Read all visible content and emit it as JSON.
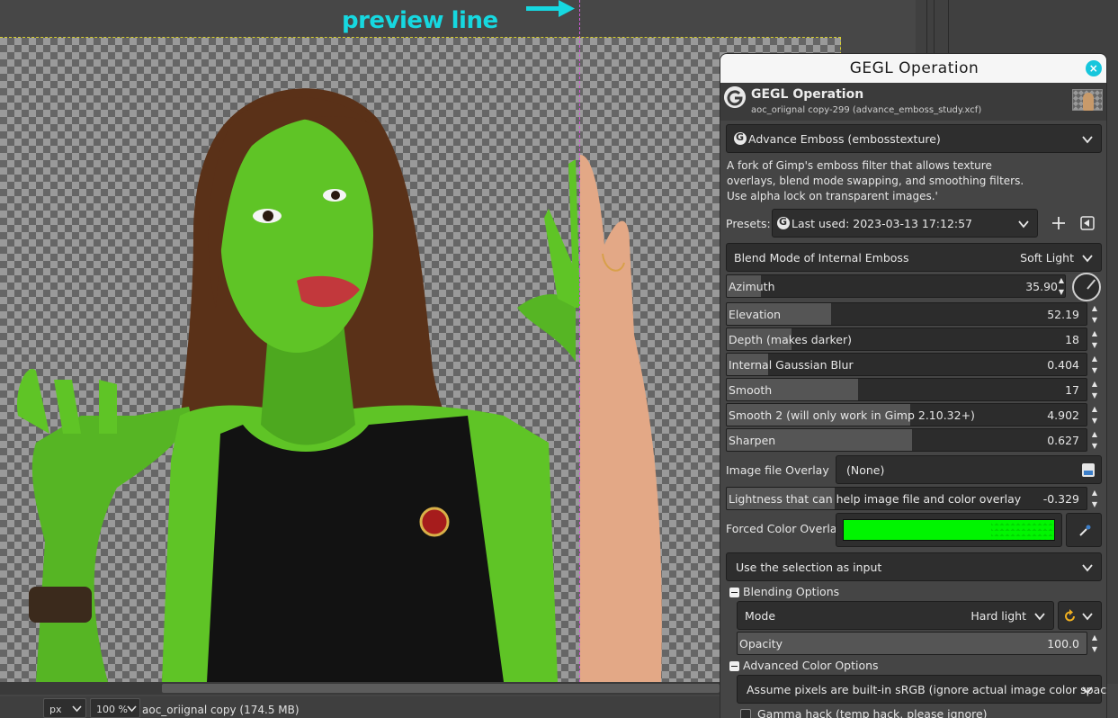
{
  "canvas": {
    "annotation": "preview line"
  },
  "statusbar": {
    "unit": "px",
    "zoom": "100 %",
    "image_info": "aoc_oriignal copy (174.5 MB)"
  },
  "dialog": {
    "window_title": "GEGL Operation",
    "header_title": "GEGL Operation",
    "header_subtitle": "aoc_oriignal copy-299 (advance_emboss_study.xcf)",
    "operation": "Advance Emboss (embosstexture)",
    "description": [
      "A fork of Gimp's emboss filter that allows texture",
      "overlays, blend mode swapping, and smoothing filters.",
      "Use alpha lock on transparent images.'"
    ],
    "presets_label": "Presets:",
    "presets_value": "Last used: 2023-03-13 17:12:57",
    "blend_label": "Blend Mode of Internal Emboss",
    "blend_value": "Soft Light",
    "sliders": [
      {
        "label": "Azimuth",
        "value": "35.90",
        "fill": 0.1
      },
      {
        "label": "Elevation",
        "value": "52.19",
        "fill": 0.29
      },
      {
        "label": "Depth (makes darker)",
        "value": "18",
        "fill": 0.18
      },
      {
        "label": "Internal Gaussian Blur",
        "value": "0.404",
        "fill": 0.115
      },
      {
        "label": "Smooth",
        "value": "17",
        "fill": 0.365
      },
      {
        "label": "Smooth 2 (will only work in Gimp 2.10.32+)",
        "value": "4.902",
        "fill": 0.51
      },
      {
        "label": "Sharpen",
        "value": "0.627",
        "fill": 0.515
      }
    ],
    "image_overlay_label": "Image file Overlay",
    "image_overlay_value": "(None)",
    "lightness_label": "Lightness that can help image file and color overlay",
    "lightness_value": "-0.329",
    "lightness_fill": 0.3,
    "forced_color_label": "Forced Color Overlay",
    "forced_color": "#00f500",
    "input_option": "Use the selection as input",
    "blending_options": "Blending Options",
    "mode_label": "Mode",
    "mode_value": "Hard light",
    "opacity_label": "Opacity",
    "opacity_value": "100.0",
    "opacity_fill": 1.0,
    "advanced_color": "Advanced Color Options",
    "color_space": "Assume pixels are built-in sRGB (ignore actual image color space)",
    "gamma_hack": "Gamma hack (temp hack, please ignore)"
  },
  "colors": {
    "accent": "#16d8e0",
    "guide": "#d05ad8",
    "skin_green": "#5fc426"
  }
}
